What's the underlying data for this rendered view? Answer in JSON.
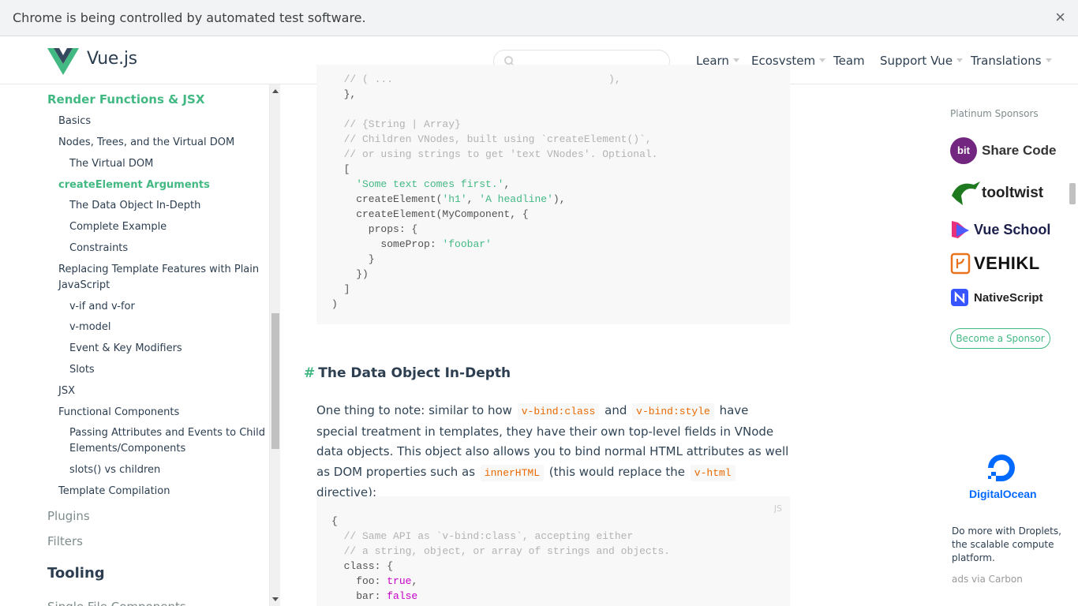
{
  "browser": {
    "infobar_text": "Chrome is being controlled by automated test software.",
    "infobar_close": "×"
  },
  "header": {
    "logo_text": "Vue.js",
    "search_placeholder": "",
    "nav": [
      {
        "label": "Learn",
        "active": true,
        "dropdown": true
      },
      {
        "label": "Ecosystem",
        "dropdown": true
      },
      {
        "label": "Team",
        "dropdown": false
      },
      {
        "label": "Support Vue",
        "dropdown": true
      },
      {
        "label": "Translations",
        "dropdown": true
      }
    ]
  },
  "sidebar": {
    "items": [
      {
        "label": "Render Functions & JSX",
        "level": "section-active"
      },
      {
        "label": "Basics",
        "level": 1
      },
      {
        "label": "Nodes, Trees, and the Virtual DOM",
        "level": 1
      },
      {
        "label": "The Virtual DOM",
        "level": 2
      },
      {
        "label": "createElement Arguments",
        "level": 1,
        "active": true
      },
      {
        "label": "The Data Object In-Depth",
        "level": 2
      },
      {
        "label": "Complete Example",
        "level": 2
      },
      {
        "label": "Constraints",
        "level": 2
      },
      {
        "label": "Replacing Template Features with Plain",
        "level": 1
      },
      {
        "label": "JavaScript",
        "level": 1
      },
      {
        "label": "v-if and v-for",
        "level": 2
      },
      {
        "label": "v-model",
        "level": 2
      },
      {
        "label": "Event & Key Modifiers",
        "level": 2
      },
      {
        "label": "Slots",
        "level": 2
      },
      {
        "label": "JSX",
        "level": 1
      },
      {
        "label": "Functional Components",
        "level": 1
      },
      {
        "label": "Passing Attributes and Events to Child",
        "level": 2
      },
      {
        "label": "Elements/Components",
        "level": 2
      },
      {
        "label": "slots() vs children",
        "level": 2
      },
      {
        "label": "Template Compilation",
        "level": 1
      },
      {
        "label": "Plugins",
        "level": "section"
      },
      {
        "label": "Filters",
        "level": "section"
      },
      {
        "label": "Tooling",
        "level": "heading"
      },
      {
        "label": "Single File Components",
        "level": "section"
      }
    ]
  },
  "main": {
    "code1_lines": [
      "  // ( ...                                   ),",
      "  },",
      "",
      "  // {String | Array}",
      "  // Children VNodes, built using `createElement()`,",
      "  // or using strings to get 'text VNodes'. Optional.",
      "  [",
      "    'Some text comes first.',",
      "    createElement('h1', 'A headline'),",
      "    createElement(MyComponent, {",
      "      props: {",
      "        someProp: 'foobar'",
      "      }",
      "    })",
      "  ]",
      ")"
    ],
    "heading_hash": "#",
    "heading": "The Data Object In-Depth",
    "para": {
      "t1": "One thing to note: similar to how",
      "c1": "v-bind:class",
      "t2": "and",
      "c2": "v-bind:style",
      "t3": "have special treatment in templates, they have their own top-level fields in VNode data objects. This object also allows you to bind normal HTML attributes as well as DOM properties such as",
      "c3": "innerHTML",
      "t4": "(this would replace the",
      "c4": "v-html",
      "t5": "directive):"
    },
    "code2_lang": "JS",
    "code2_lines": [
      "{",
      "  // Same API as `v-bind:class`, accepting either",
      "  // a string, object, or array of strings and objects.",
      "  class: {",
      "    foo: true,",
      "    bar: false"
    ]
  },
  "right": {
    "sponsor_title": "Platinum Sponsors",
    "sponsors": [
      "Share Code",
      "tooltwist",
      "Vue School",
      "VEHIKL",
      "NativeScript"
    ],
    "bit_badge": "bit",
    "become_sponsor": "Become a Sponsor",
    "ad_brand": "DigitalOcean",
    "ad_text": "Do more with Droplets, the scalable compute platform.",
    "ad_via": "ads via Carbon"
  },
  "colors": {
    "accent": "#42b983",
    "inline_code": "#e96900",
    "keyword": "#c700c7",
    "comment": "#b3b3b3",
    "digitalocean": "#0069ff"
  }
}
